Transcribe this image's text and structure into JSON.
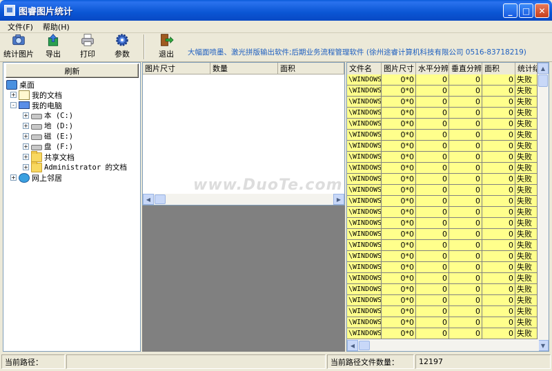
{
  "window": {
    "title": "图睿图片统计",
    "minimize": "_",
    "maximize": "□",
    "close": "✕"
  },
  "menu": [
    {
      "label": "文件(F)"
    },
    {
      "label": "帮助(H)"
    }
  ],
  "toolbar": {
    "stats_label": "统计图片",
    "export_label": "导出",
    "print_label": "打印",
    "params_label": "参数",
    "exit_label": "退出",
    "ad": "大幅面喷墨、激光拼版输出软件;后期业务流程管理软件 (徐州途睿计算机科技有限公司 0516-83718219)"
  },
  "left": {
    "refresh_label": "刷新",
    "tree": [
      {
        "label": "桌面",
        "icon": "desktop-icon",
        "indent": 0,
        "expander": ""
      },
      {
        "label": "我的文档",
        "icon": "docs-icon",
        "indent": 1,
        "expander": "+"
      },
      {
        "label": "我的电脑",
        "icon": "computer-icon",
        "indent": 1,
        "expander": "-"
      },
      {
        "label": "本 (C:)",
        "icon": "drive-icon",
        "indent": 2,
        "expander": "+",
        "mono": true
      },
      {
        "label": "地 (D:)",
        "icon": "drive-icon",
        "indent": 2,
        "expander": "+",
        "mono": true
      },
      {
        "label": "磁 (E:)",
        "icon": "drive-icon",
        "indent": 2,
        "expander": "+",
        "mono": true
      },
      {
        "label": "盘 (F:)",
        "icon": "drive-icon",
        "indent": 2,
        "expander": "+",
        "mono": true
      },
      {
        "label": "共享文档",
        "icon": "folder-icon",
        "indent": 2,
        "expander": "+"
      },
      {
        "label": "Administrator 的文档",
        "icon": "folder-icon",
        "indent": 2,
        "expander": "+",
        "mono": true
      },
      {
        "label": "网上邻居",
        "icon": "network-icon",
        "indent": 1,
        "expander": "+"
      }
    ]
  },
  "middle": {
    "columns": [
      "图片尺寸",
      "数量",
      "面积"
    ]
  },
  "grid": {
    "columns": [
      "文件名",
      "图片尺寸",
      "水平分辨",
      "垂直分辨",
      "面积",
      "统计结"
    ],
    "row_template": {
      "name": "\\WINDOWS",
      "size": "0*0",
      "hres": "0",
      "vres": "0",
      "area": "0",
      "status": "失败"
    },
    "row_count": 24
  },
  "status": {
    "path_label": "当前路径：",
    "path_value": "",
    "count_label": "当前路径文件数量：",
    "count_value": "12197"
  },
  "watermark": "www.DuoTe.com"
}
